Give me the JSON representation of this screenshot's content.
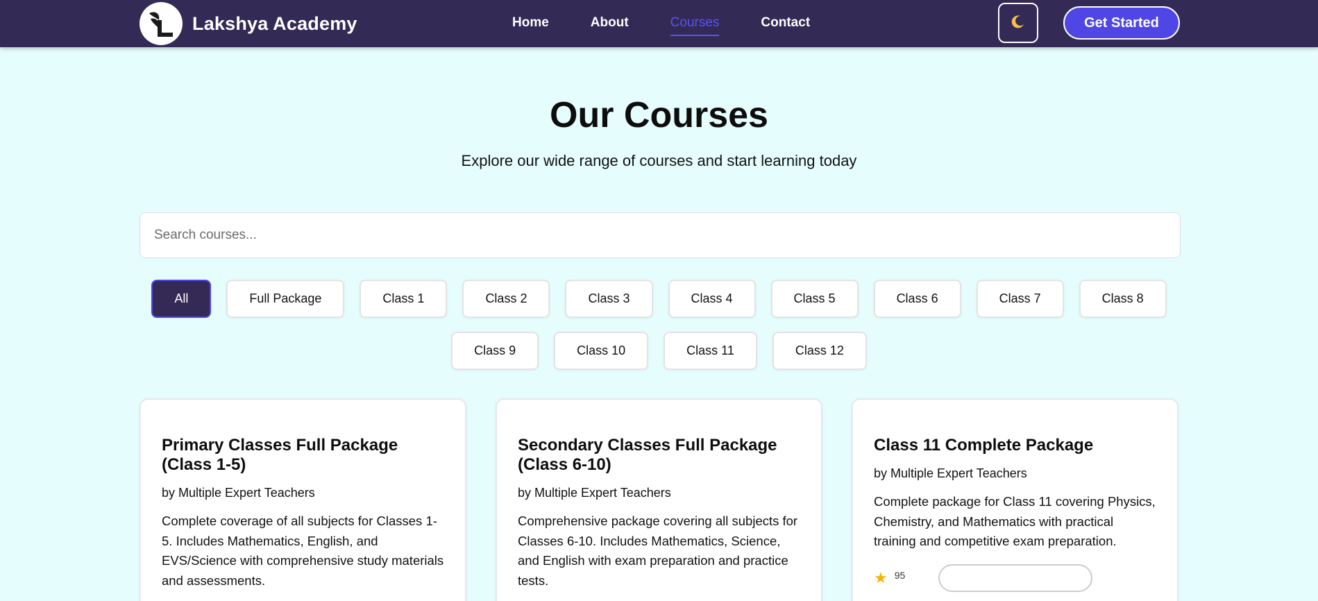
{
  "nav": {
    "brand": "Lakshya Academy",
    "links": [
      {
        "label": "Home"
      },
      {
        "label": "About"
      },
      {
        "label": "Courses",
        "active": true
      },
      {
        "label": "Contact"
      }
    ],
    "theme_icon": "crescent-moon-icon",
    "cta_label": "Get Started"
  },
  "hero": {
    "title": "Our Courses",
    "subtitle": "Explore our wide range of courses and start learning today"
  },
  "search": {
    "placeholder": "Search courses...",
    "value": ""
  },
  "filters": {
    "row1": [
      "All",
      "Full Package",
      "Class 1",
      "Class 2",
      "Class 3",
      "Class 4",
      "Class 5",
      "Class 6",
      "Class 7",
      "Class 8"
    ],
    "row2": [
      "Class 9",
      "Class 10",
      "Class 11",
      "Class 12"
    ],
    "active": "All"
  },
  "courses": [
    {
      "title": "Primary Classes Full Package (Class 1-5)",
      "teacher": "by Multiple Expert Teachers",
      "description": "Complete coverage of all subjects for Classes 1-5. Includes Mathematics, English, and EVS/Science with comprehensive study materials and assessments."
    },
    {
      "title": "Secondary Classes Full Package (Class 6-10)",
      "teacher": "by Multiple Expert Teachers",
      "description": "Comprehensive package covering all subjects for Classes 6-10. Includes Mathematics, Science, and English with exam preparation and practice tests."
    },
    {
      "title": "Class 11 Complete Package",
      "teacher": "by Multiple Expert Teachers",
      "description": "Complete package for Class 11 covering Physics, Chemistry, and Mathematics with practical training and competitive exam preparation.",
      "rating_text": "95"
    }
  ],
  "colors": {
    "navbar": "#332a55",
    "accent": "#4f46e5",
    "page_bg": "#e6fdfd"
  }
}
